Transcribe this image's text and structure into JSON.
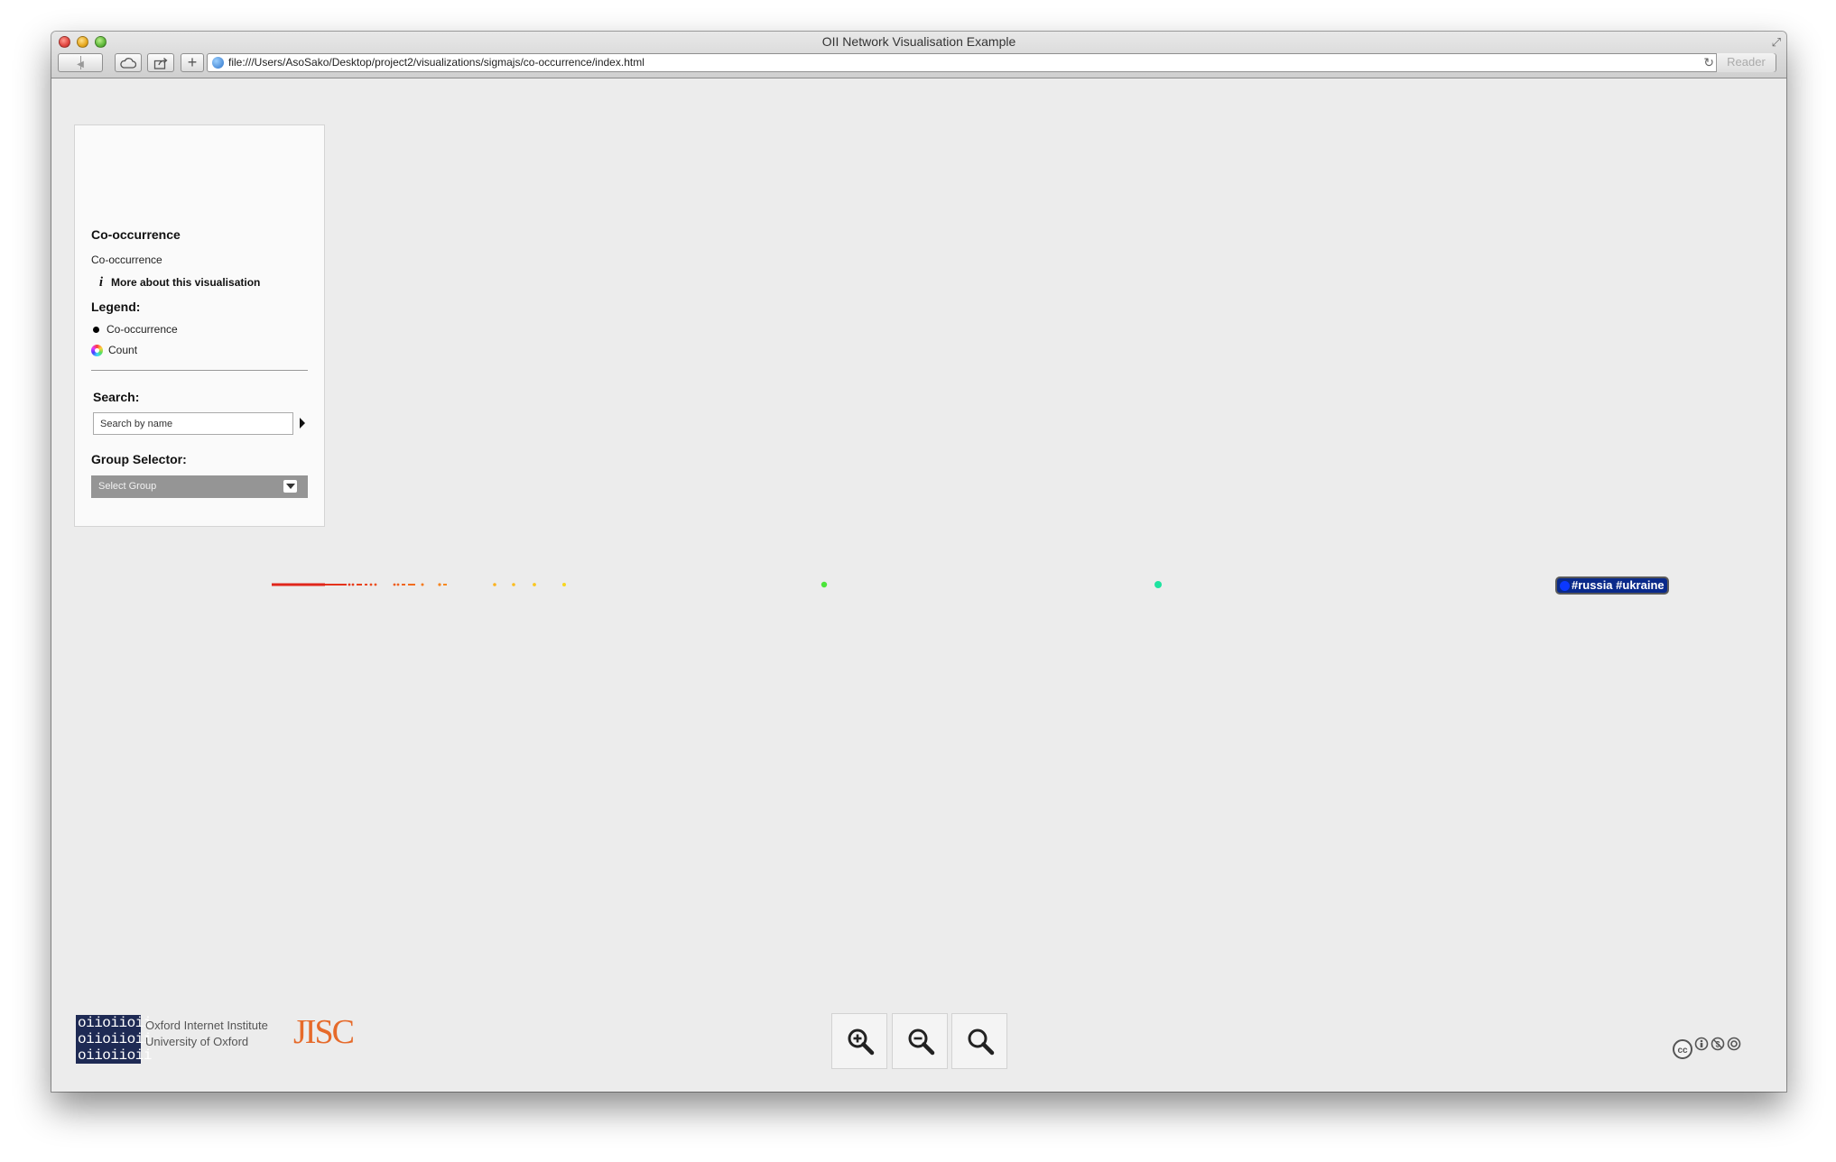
{
  "window": {
    "title": "OII Network Visualisation Example",
    "url": "file:///Users/AsoSako/Desktop/project2/visualizations/sigmajs/co-occurrence/index.html",
    "reader_label": "Reader",
    "nav_back": "◀",
    "nav_forward": "▶",
    "new_tab": "+",
    "reload": "↻",
    "fullscreen": "⤢"
  },
  "panel": {
    "title": "Co-occurrence",
    "subtitle": "Co-occurrence",
    "more_info_icon": "i",
    "more_info": "More about this visualisation",
    "legend_title": "Legend:",
    "legend": [
      {
        "icon": "black-dot",
        "label": "Co-occurrence"
      },
      {
        "icon": "color-wheel",
        "label": "Count"
      }
    ],
    "search_title": "Search:",
    "search_placeholder": "Search by name",
    "group_title": "Group Selector:",
    "group_value": "Select Group"
  },
  "graph": {
    "highlighted_node_label": "#russia #ukraine",
    "highlight_color": "#0b38ff"
  },
  "footer": {
    "logo_text": [
      "oiioiioii",
      "oiioiioii",
      "oiioiioii"
    ],
    "institute_line1": "Oxford Internet Institute",
    "institute_line2": "University of Oxford",
    "partner": "JISC",
    "zoom_buttons": [
      "zoom-in",
      "zoom-out",
      "zoom-reset"
    ],
    "license_icons": "cc-by-nc-sa"
  }
}
